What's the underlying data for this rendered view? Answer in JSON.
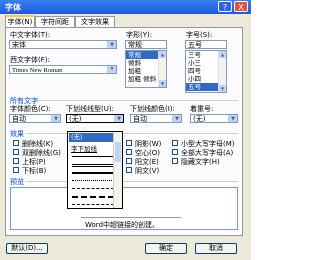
{
  "window": {
    "title": "字体",
    "help_button": "?",
    "close_button": "X"
  },
  "tabs": [
    {
      "label": "字体(N)"
    },
    {
      "label": "字符间距(R)"
    },
    {
      "label": "文字效果(X)"
    }
  ],
  "font": {
    "chinese_label": "中文字体(T):",
    "chinese_value": "宋体",
    "western_label": "西文字体(F):",
    "western_value": "Times New Roman",
    "style_label": "字形(Y):",
    "style_value": "常规",
    "style_options": [
      "常规",
      "倾斜",
      "加粗",
      "加粗 倾斜"
    ],
    "size_label": "字号(S):",
    "size_value": "五号",
    "size_options": [
      "三号",
      "小三",
      "四号",
      "小四",
      "五号"
    ]
  },
  "all_text": {
    "section_label": "所有文字",
    "color_label": "字体颜色(C):",
    "color_value": "自动",
    "underline_label": "下划线线型(U):",
    "underline_value": "(无)",
    "underline_color_label": "下划线颜色(I):",
    "underline_color_value": "自动",
    "emphasis_label": "着重号:",
    "emphasis_value": "(无)"
  },
  "underline_dropdown": {
    "items": [
      "(无)",
      "字下加线"
    ],
    "line_styles": [
      "solid",
      "double",
      "thick",
      "dotted",
      "dashed",
      "dash-dot",
      "dash-dot-dot",
      "dashed"
    ]
  },
  "effects": {
    "section_label": "效果",
    "left": [
      "删除线(K)",
      "双删除线(G)",
      "上标(P)",
      "下标(B)"
    ],
    "right": [
      "阴影(W)",
      "空心(O)",
      "阳文(E)",
      "阴文(V)",
      "小型大写字母(M)",
      "全部大写字母(A)",
      "隐藏文字(H)"
    ]
  },
  "preview": {
    "section_label": "预览",
    "text": "Word中超链接的创建。"
  },
  "buttons": {
    "default": "默认(D)...",
    "ok": "确定",
    "cancel": "取消"
  }
}
